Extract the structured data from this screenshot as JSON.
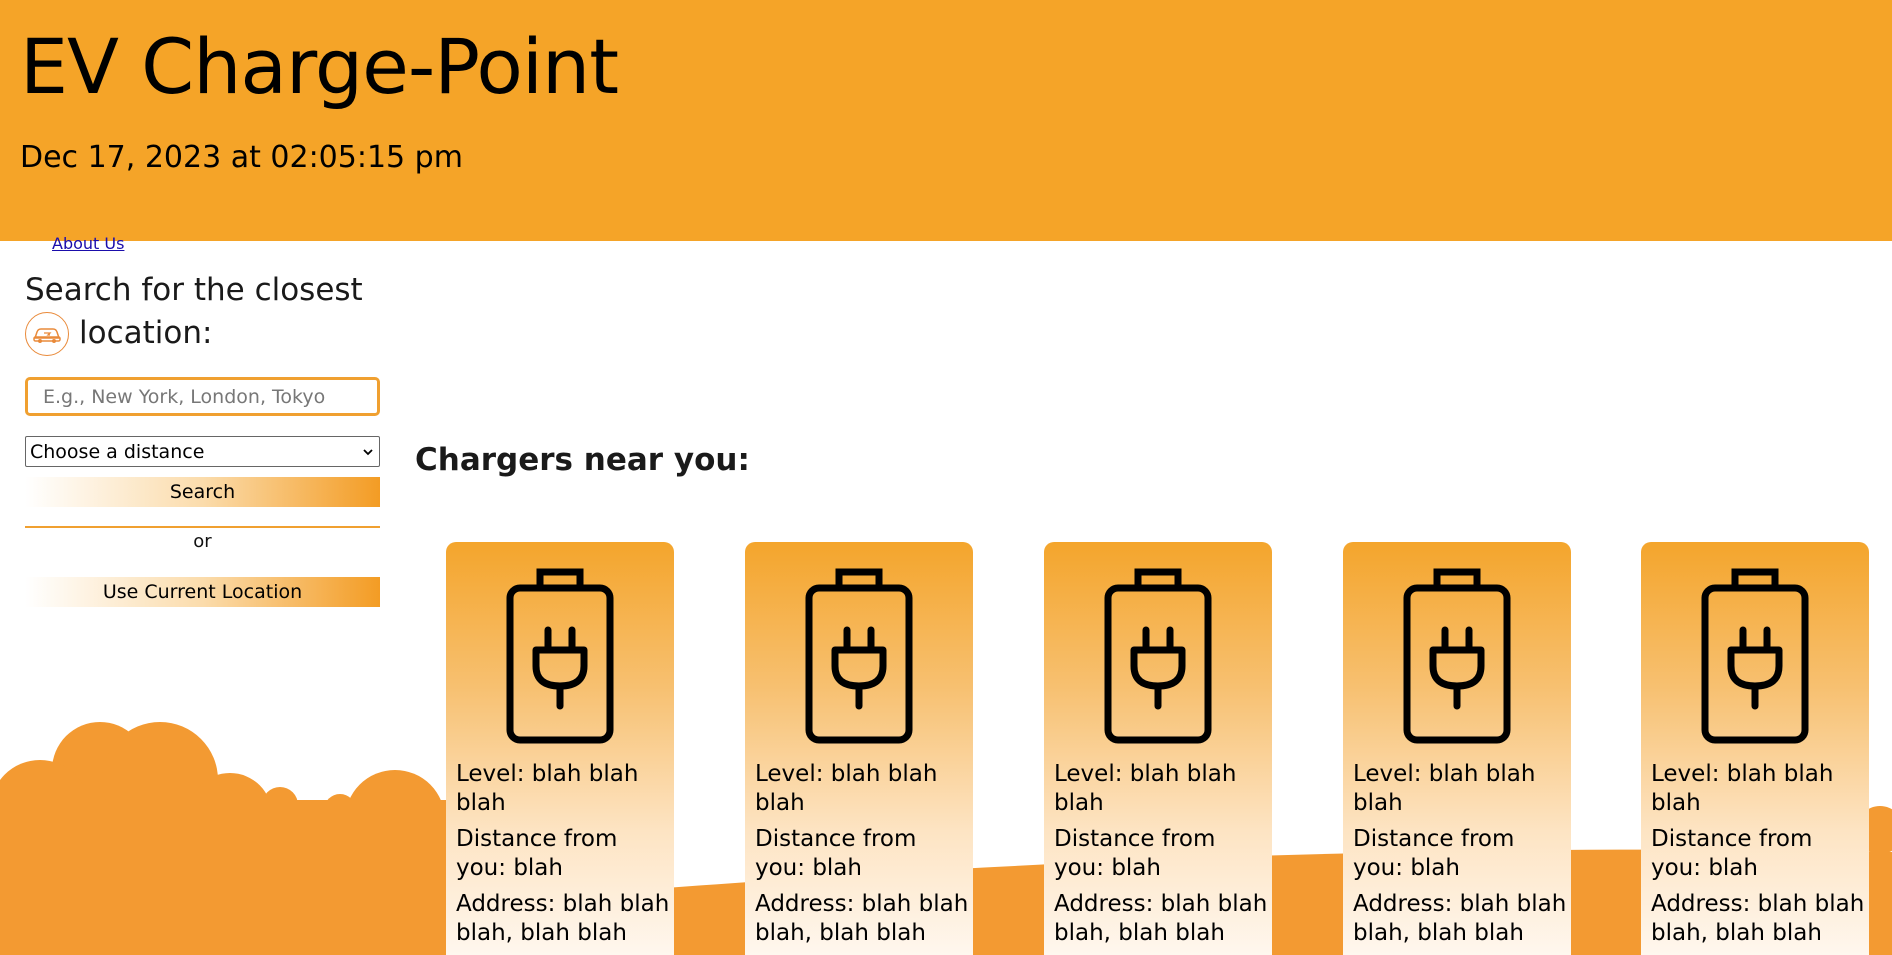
{
  "header": {
    "title": "EV Charge-Point",
    "datetime": "Dec 17, 2023 at 02:05:15 pm",
    "bg_color": "#f5a428"
  },
  "nav": {
    "about_link": "About Us"
  },
  "search": {
    "heading_line1": "Search for the closest",
    "heading_line2": "location:",
    "input_placeholder": "E.g., New York, London, Tokyo",
    "distance_select": "Choose a distance",
    "search_button": "Search",
    "or_text": "or",
    "location_button": "Use Current Location"
  },
  "results": {
    "title": "Chargers near you:",
    "cards": [
      {
        "level": "Level: blah blah blah",
        "distance": "Distance from you: blah",
        "address": "Address: blah blah blah, blah blah"
      },
      {
        "level": "Level: blah blah blah",
        "distance": "Distance from you: blah",
        "address": "Address: blah blah blah, blah blah"
      },
      {
        "level": "Level: blah blah blah",
        "distance": "Distance from you: blah",
        "address": "Address: blah blah blah, blah blah"
      },
      {
        "level": "Level: blah blah blah",
        "distance": "Distance from you: blah",
        "address": "Address: blah blah blah, blah blah"
      },
      {
        "level": "Level: blah blah blah",
        "distance": "Distance from you: blah",
        "address": "Address: blah blah blah, blah blah"
      }
    ]
  },
  "icons": {
    "card_icon": "battery-plug-icon",
    "search_badge": "car-icon"
  },
  "colors": {
    "accent": "#f5a428",
    "hills": "#f39a32"
  }
}
